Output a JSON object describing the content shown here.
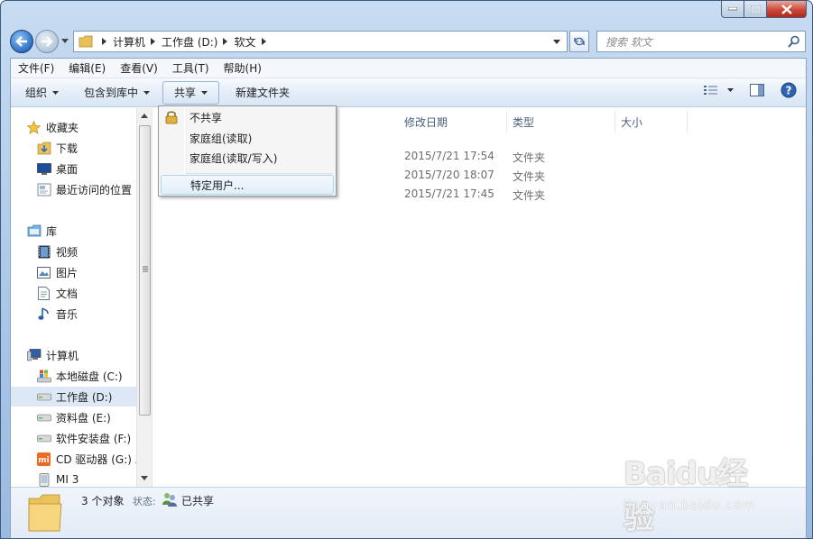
{
  "window": {
    "breadcrumb": [
      "计算机",
      "工作盘 (D:)",
      "软文"
    ],
    "search_placeholder": "搜索 软文"
  },
  "menubar": [
    "文件(F)",
    "编辑(E)",
    "查看(V)",
    "工具(T)",
    "帮助(H)"
  ],
  "toolbar": {
    "organize": "组织",
    "include_library": "包含到库中",
    "share": "共享",
    "new_folder": "新建文件夹"
  },
  "navigation": {
    "favorites": {
      "label": "收藏夹",
      "items": [
        "下载",
        "桌面",
        "最近访问的位置"
      ]
    },
    "libraries": {
      "label": "库",
      "items": [
        "视频",
        "图片",
        "文档",
        "音乐"
      ]
    },
    "computer": {
      "label": "计算机",
      "items": [
        "本地磁盘 (C:)",
        "工作盘 (D:)",
        "资料盘 (E:)",
        "软件安装盘 (F:)",
        "CD 驱动器 (G:) X",
        "MI 3"
      ]
    }
  },
  "columns": [
    "修改日期",
    "类型",
    "大小"
  ],
  "files": [
    {
      "date": "2015/7/21 17:54",
      "type": "文件夹"
    },
    {
      "date": "2015/7/20 18:07",
      "type": "文件夹"
    },
    {
      "date": "2015/7/21 17:45",
      "type": "文件夹"
    }
  ],
  "share_menu": [
    "不共享",
    "家庭组(读取)",
    "家庭组(读取/写入)",
    "特定用户..."
  ],
  "details": {
    "count": "3 个对象",
    "status_label": "状态:",
    "status_value": "已共享"
  },
  "watermark": {
    "logo": "Baidu经验",
    "url": "jingyan.baidu.com"
  },
  "colors": {
    "title_bar": "#a9c6e6",
    "selection": "#dde8f6",
    "accent": "#2f6fc2"
  }
}
